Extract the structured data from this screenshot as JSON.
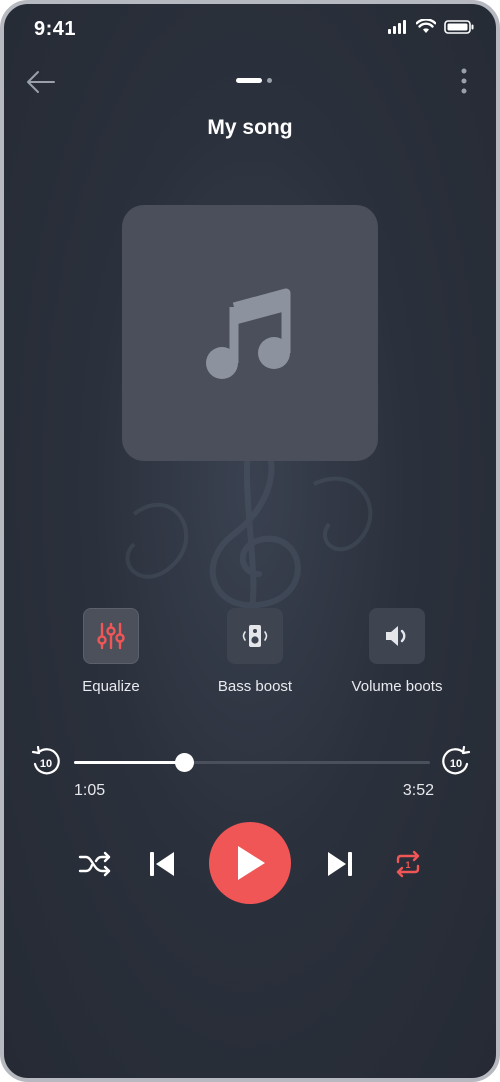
{
  "status": {
    "time": "9:41"
  },
  "song": {
    "title": "My song"
  },
  "features": [
    {
      "label": "Equalize",
      "active": true
    },
    {
      "label": "Bass boost",
      "active": false
    },
    {
      "label": "Volume boots",
      "active": false
    }
  ],
  "progress": {
    "current": "1:05",
    "total": "3:52",
    "fraction": 0.31,
    "skip_back_seconds": "10",
    "skip_forward_seconds": "10"
  },
  "repeat": {
    "mode_label": "1"
  },
  "pager": {
    "pages": 2,
    "active_index": 0
  },
  "colors": {
    "accent": "#f05656",
    "background": "#2b313c",
    "art_bg": "#4a4f5b",
    "icon_muted": "#8d939e"
  },
  "icons": [
    "back-arrow-icon",
    "more-vertical-icon",
    "music-note-icon",
    "equalizer-icon",
    "speaker-icon",
    "volume-icon",
    "rewind-10-icon",
    "forward-10-icon",
    "shuffle-icon",
    "previous-icon",
    "play-icon",
    "next-icon",
    "repeat-one-icon",
    "signal-icon",
    "wifi-icon",
    "battery-icon"
  ]
}
